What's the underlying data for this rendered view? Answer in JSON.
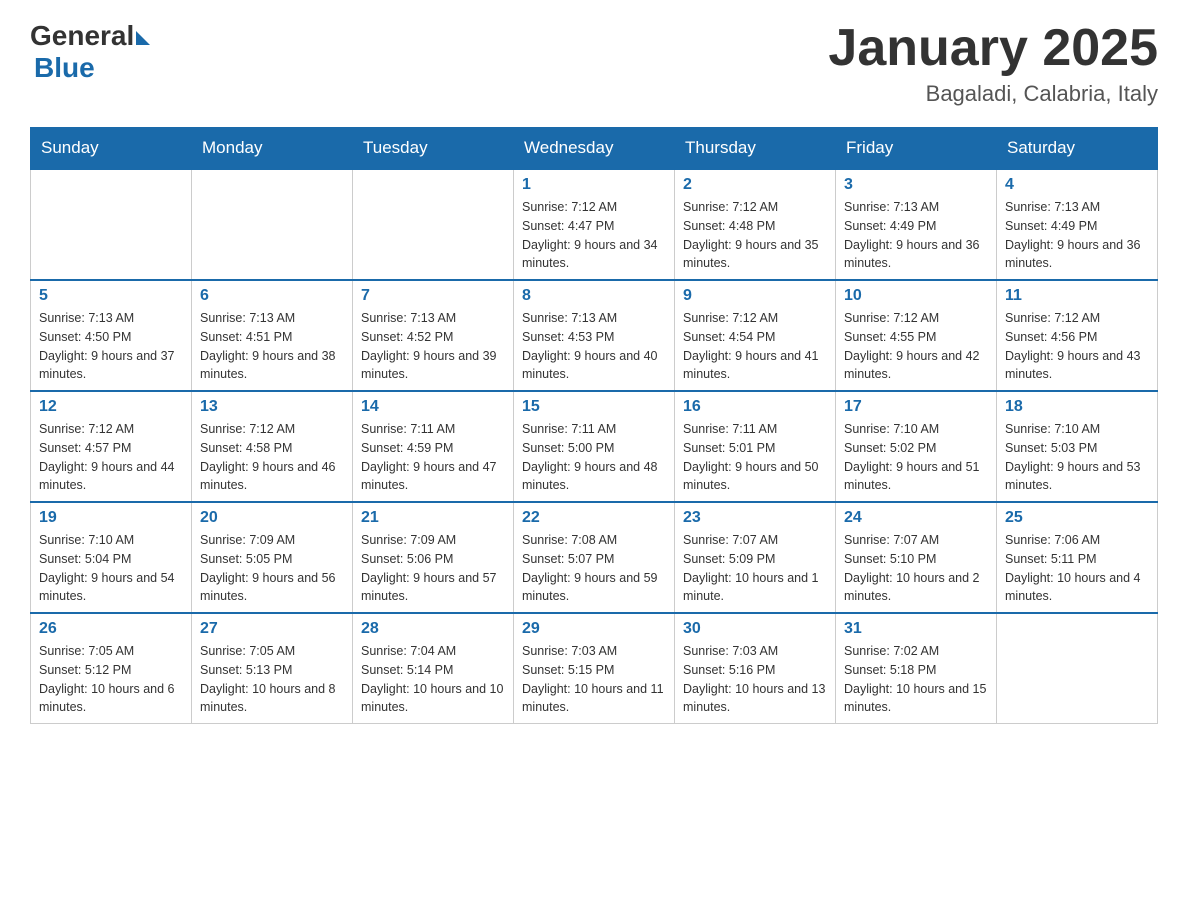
{
  "logo": {
    "general": "General",
    "blue": "Blue"
  },
  "title": "January 2025",
  "location": "Bagaladi, Calabria, Italy",
  "weekdays": [
    "Sunday",
    "Monday",
    "Tuesday",
    "Wednesday",
    "Thursday",
    "Friday",
    "Saturday"
  ],
  "weeks": [
    [
      {
        "day": "",
        "info": ""
      },
      {
        "day": "",
        "info": ""
      },
      {
        "day": "",
        "info": ""
      },
      {
        "day": "1",
        "info": "Sunrise: 7:12 AM\nSunset: 4:47 PM\nDaylight: 9 hours and 34 minutes."
      },
      {
        "day": "2",
        "info": "Sunrise: 7:12 AM\nSunset: 4:48 PM\nDaylight: 9 hours and 35 minutes."
      },
      {
        "day": "3",
        "info": "Sunrise: 7:13 AM\nSunset: 4:49 PM\nDaylight: 9 hours and 36 minutes."
      },
      {
        "day": "4",
        "info": "Sunrise: 7:13 AM\nSunset: 4:49 PM\nDaylight: 9 hours and 36 minutes."
      }
    ],
    [
      {
        "day": "5",
        "info": "Sunrise: 7:13 AM\nSunset: 4:50 PM\nDaylight: 9 hours and 37 minutes."
      },
      {
        "day": "6",
        "info": "Sunrise: 7:13 AM\nSunset: 4:51 PM\nDaylight: 9 hours and 38 minutes."
      },
      {
        "day": "7",
        "info": "Sunrise: 7:13 AM\nSunset: 4:52 PM\nDaylight: 9 hours and 39 minutes."
      },
      {
        "day": "8",
        "info": "Sunrise: 7:13 AM\nSunset: 4:53 PM\nDaylight: 9 hours and 40 minutes."
      },
      {
        "day": "9",
        "info": "Sunrise: 7:12 AM\nSunset: 4:54 PM\nDaylight: 9 hours and 41 minutes."
      },
      {
        "day": "10",
        "info": "Sunrise: 7:12 AM\nSunset: 4:55 PM\nDaylight: 9 hours and 42 minutes."
      },
      {
        "day": "11",
        "info": "Sunrise: 7:12 AM\nSunset: 4:56 PM\nDaylight: 9 hours and 43 minutes."
      }
    ],
    [
      {
        "day": "12",
        "info": "Sunrise: 7:12 AM\nSunset: 4:57 PM\nDaylight: 9 hours and 44 minutes."
      },
      {
        "day": "13",
        "info": "Sunrise: 7:12 AM\nSunset: 4:58 PM\nDaylight: 9 hours and 46 minutes."
      },
      {
        "day": "14",
        "info": "Sunrise: 7:11 AM\nSunset: 4:59 PM\nDaylight: 9 hours and 47 minutes."
      },
      {
        "day": "15",
        "info": "Sunrise: 7:11 AM\nSunset: 5:00 PM\nDaylight: 9 hours and 48 minutes."
      },
      {
        "day": "16",
        "info": "Sunrise: 7:11 AM\nSunset: 5:01 PM\nDaylight: 9 hours and 50 minutes."
      },
      {
        "day": "17",
        "info": "Sunrise: 7:10 AM\nSunset: 5:02 PM\nDaylight: 9 hours and 51 minutes."
      },
      {
        "day": "18",
        "info": "Sunrise: 7:10 AM\nSunset: 5:03 PM\nDaylight: 9 hours and 53 minutes."
      }
    ],
    [
      {
        "day": "19",
        "info": "Sunrise: 7:10 AM\nSunset: 5:04 PM\nDaylight: 9 hours and 54 minutes."
      },
      {
        "day": "20",
        "info": "Sunrise: 7:09 AM\nSunset: 5:05 PM\nDaylight: 9 hours and 56 minutes."
      },
      {
        "day": "21",
        "info": "Sunrise: 7:09 AM\nSunset: 5:06 PM\nDaylight: 9 hours and 57 minutes."
      },
      {
        "day": "22",
        "info": "Sunrise: 7:08 AM\nSunset: 5:07 PM\nDaylight: 9 hours and 59 minutes."
      },
      {
        "day": "23",
        "info": "Sunrise: 7:07 AM\nSunset: 5:09 PM\nDaylight: 10 hours and 1 minute."
      },
      {
        "day": "24",
        "info": "Sunrise: 7:07 AM\nSunset: 5:10 PM\nDaylight: 10 hours and 2 minutes."
      },
      {
        "day": "25",
        "info": "Sunrise: 7:06 AM\nSunset: 5:11 PM\nDaylight: 10 hours and 4 minutes."
      }
    ],
    [
      {
        "day": "26",
        "info": "Sunrise: 7:05 AM\nSunset: 5:12 PM\nDaylight: 10 hours and 6 minutes."
      },
      {
        "day": "27",
        "info": "Sunrise: 7:05 AM\nSunset: 5:13 PM\nDaylight: 10 hours and 8 minutes."
      },
      {
        "day": "28",
        "info": "Sunrise: 7:04 AM\nSunset: 5:14 PM\nDaylight: 10 hours and 10 minutes."
      },
      {
        "day": "29",
        "info": "Sunrise: 7:03 AM\nSunset: 5:15 PM\nDaylight: 10 hours and 11 minutes."
      },
      {
        "day": "30",
        "info": "Sunrise: 7:03 AM\nSunset: 5:16 PM\nDaylight: 10 hours and 13 minutes."
      },
      {
        "day": "31",
        "info": "Sunrise: 7:02 AM\nSunset: 5:18 PM\nDaylight: 10 hours and 15 minutes."
      },
      {
        "day": "",
        "info": ""
      }
    ]
  ]
}
